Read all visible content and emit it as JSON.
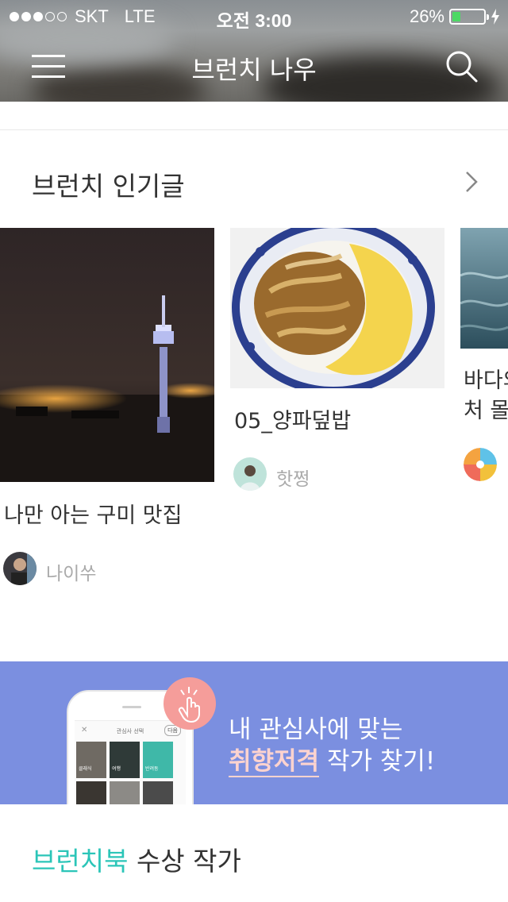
{
  "status_bar": {
    "carrier": "SKT",
    "network": "LTE",
    "time": "오전 3:00",
    "battery_percent": "26%",
    "battery_level": 0.26,
    "signal_bars": 3,
    "signal_total": 5
  },
  "header": {
    "title": "브런치 나우",
    "menu_icon": "hamburger-menu-icon",
    "search_icon": "search-icon"
  },
  "popular": {
    "title": "브런치 인기글",
    "more_icon": "chevron-right-icon",
    "cards": [
      {
        "title": "나만 아는 구미 맛집",
        "author": "나이쑤"
      },
      {
        "title": "05_양파덮밥",
        "author": "핫쩡"
      },
      {
        "title_line1": "바다의",
        "title_line2": "처 몰"
      }
    ]
  },
  "banner": {
    "line1": "내 관심사에 맞는",
    "highlight": "취향저격",
    "line2_rest": " 작가 찾기!",
    "phone": {
      "close": "✕",
      "title": "관심사 선택",
      "next": "다음",
      "tiles": [
        "클래식",
        "여행",
        "반려동"
      ]
    },
    "hand_icon": "tap-hand-icon"
  },
  "award": {
    "accent": "브런치북",
    "rest": " 수상 작가"
  },
  "colors": {
    "banner_bg": "#7b8fe0",
    "accent_teal": "#2bc5b8",
    "highlight_pink": "#fdd3cf",
    "badge_pink": "#f59d9a",
    "battery_green": "#4cd964"
  }
}
